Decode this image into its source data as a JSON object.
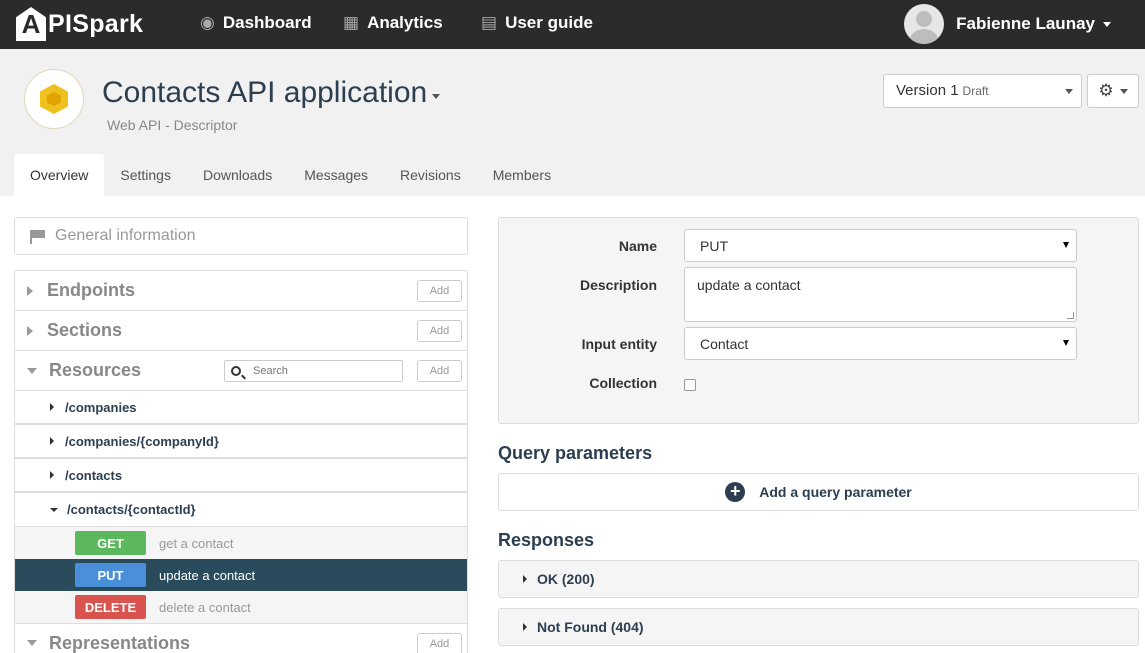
{
  "navbar": {
    "logo_mark": "A",
    "logo_text": "PISpark",
    "links": [
      {
        "label": "Dashboard",
        "icon": "eye-icon"
      },
      {
        "label": "Analytics",
        "icon": "bar-chart-icon"
      },
      {
        "label": "User guide",
        "icon": "book-icon"
      }
    ],
    "user_name": "Fabienne Launay"
  },
  "header": {
    "title": "Contacts API application",
    "subtitle": "Web API - Descriptor",
    "version_label": "Version 1",
    "version_status": "Draft",
    "tabs": [
      "Overview",
      "Settings",
      "Downloads",
      "Messages",
      "Revisions",
      "Members"
    ],
    "active_tab": "Overview"
  },
  "sidebar": {
    "general_info": "General information",
    "add_label": "Add",
    "sections": {
      "endpoints": "Endpoints",
      "sections": "Sections",
      "resources": "Resources",
      "representations": "Representations"
    },
    "search_placeholder": "Search",
    "resources": [
      {
        "path": "/companies",
        "expanded": false
      },
      {
        "path": "/companies/{companyId}",
        "expanded": false
      },
      {
        "path": "/contacts",
        "expanded": false
      },
      {
        "path": "/contacts/{contactId}",
        "expanded": true
      }
    ],
    "methods": [
      {
        "verb": "GET",
        "desc": "get a contact",
        "color": "#5cb85c"
      },
      {
        "verb": "PUT",
        "desc": "update a contact",
        "color": "#4a90d9",
        "selected": true
      },
      {
        "verb": "DELETE",
        "desc": "delete a contact",
        "color": "#d9534f"
      }
    ]
  },
  "form": {
    "name_label": "Name",
    "name_value": "PUT",
    "description_label": "Description",
    "description_value": "update a contact",
    "input_entity_label": "Input entity",
    "input_entity_value": "Contact",
    "collection_label": "Collection",
    "collection_checked": false
  },
  "query": {
    "heading": "Query parameters",
    "add_label": "Add a query parameter"
  },
  "responses": {
    "heading": "Responses",
    "items": [
      "OK (200)",
      "Not Found (404)"
    ]
  }
}
